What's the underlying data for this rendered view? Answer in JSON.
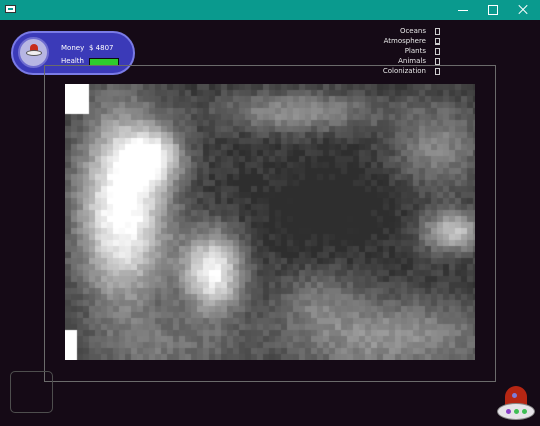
{
  "window": {
    "controls": [
      "minimize",
      "maximize",
      "close"
    ]
  },
  "hud": {
    "money_label": "Money",
    "money_value": "$ 4807",
    "health_label": "Health",
    "health_fraction": 1.0,
    "colors": {
      "panel": "#3b3ab8",
      "health": "#2ecc2e"
    }
  },
  "planet_stats": [
    {
      "label": "Oceans",
      "level": 0.0
    },
    {
      "label": "Atmosphere",
      "level": 0.2
    },
    {
      "label": "Plants",
      "level": 0.0
    },
    {
      "label": "Animals",
      "level": 0.0
    },
    {
      "label": "Colonization",
      "level": 0.0
    }
  ],
  "map": {
    "description_colors": {
      "low": "#3a3a3a",
      "mid": "#7a7a7a",
      "high": "#ffffff"
    }
  },
  "icons": {
    "avatar": "ufo-icon",
    "ship": "ufo-ship-icon"
  }
}
